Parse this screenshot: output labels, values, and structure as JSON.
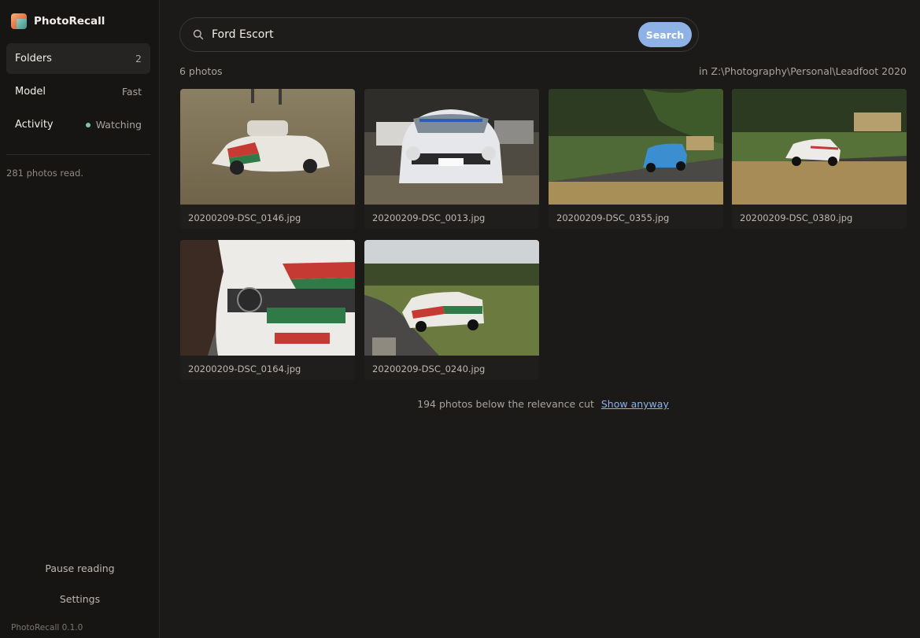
{
  "app": {
    "name": "PhotoRecall",
    "version": "PhotoRecall 0.1.0"
  },
  "sidebar": {
    "items": [
      {
        "label": "Folders",
        "value": "2"
      },
      {
        "label": "Model",
        "value": "Fast"
      },
      {
        "label": "Activity",
        "value": "Watching"
      }
    ],
    "photos_read": "281 photos read.",
    "pause_label": "Pause reading",
    "settings_label": "Settings"
  },
  "search": {
    "query": "Ford Escort",
    "button_label": "Search"
  },
  "results": {
    "count_label": "6 photos",
    "folder_label": "in Z:\\Photography\\Personal\\Leadfoot 2020",
    "photos": [
      {
        "filename": "20200209-DSC_0146.jpg"
      },
      {
        "filename": "20200209-DSC_0013.jpg"
      },
      {
        "filename": "20200209-DSC_0355.jpg"
      },
      {
        "filename": "20200209-DSC_0380.jpg"
      },
      {
        "filename": "20200209-DSC_0164.jpg"
      },
      {
        "filename": "20200209-DSC_0240.jpg"
      }
    ],
    "below_cut_label": "194 photos below the relevance cut",
    "show_anyway_label": "Show anyway"
  },
  "colors": {
    "accent": "#8eb2e6",
    "status_dot": "#7fc3a9",
    "background": "#1b1a19",
    "sidebar": "#161514"
  }
}
